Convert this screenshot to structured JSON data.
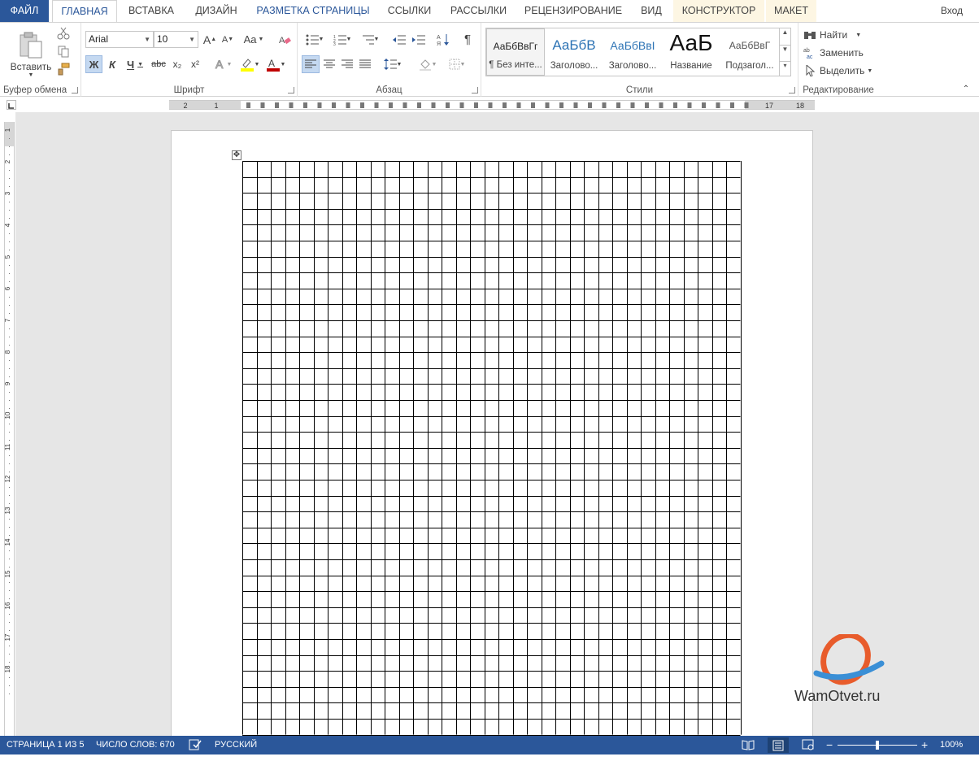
{
  "tabs": [
    {
      "label": "ФАЙЛ",
      "kind": "file"
    },
    {
      "label": "ГЛАВНАЯ",
      "kind": "active"
    },
    {
      "label": "ВСТАВКА",
      "kind": "normal"
    },
    {
      "label": "ДИЗАЙН",
      "kind": "normal"
    },
    {
      "label": "РАЗМЕТКА СТРАНИЦЫ",
      "kind": "blue"
    },
    {
      "label": "ССЫЛКИ",
      "kind": "normal"
    },
    {
      "label": "РАССЫЛКИ",
      "kind": "normal"
    },
    {
      "label": "РЕЦЕНЗИРОВАНИЕ",
      "kind": "normal"
    },
    {
      "label": "ВИД",
      "kind": "normal"
    },
    {
      "label": "КОНСТРУКТОР",
      "kind": "contextual"
    },
    {
      "label": "МАКЕТ",
      "kind": "contextual"
    }
  ],
  "signin": "Вход",
  "clipboard": {
    "paste_label": "Вставить",
    "group_label": "Буфер обмена",
    "icons": [
      "paste-icon",
      "cut-icon",
      "copy-icon",
      "format-painter-icon"
    ]
  },
  "font": {
    "name": "Arial",
    "size": "10",
    "group_label": "Шрифт",
    "bold": "Ж",
    "italic": "К",
    "underline": "Ч",
    "strike": "abc",
    "subscript": "x₂",
    "superscript": "x²",
    "grow": "A",
    "shrink": "A",
    "case": "Aa",
    "highlight_color": "#ffff00",
    "font_color": "#c00000"
  },
  "paragraph": {
    "group_label": "Абзац",
    "pilcrow": "¶",
    "icons": [
      "bullets-icon",
      "numbering-icon",
      "multilevel-list-icon",
      "decrease-indent-icon",
      "increase-indent-icon",
      "sort-icon",
      "show-marks-icon",
      "align-left-icon",
      "align-center-icon",
      "align-right-icon",
      "justify-icon",
      "line-spacing-icon",
      "shading-icon",
      "borders-icon"
    ]
  },
  "styles": {
    "group_label": "Стили",
    "items": [
      {
        "sample": "АаБбВвГг",
        "name": "¶ Без инте...",
        "selected": true
      },
      {
        "sample": "АаБбВ",
        "name": "Заголово...",
        "selected": false
      },
      {
        "sample": "АаБбВвІ",
        "name": "Заголово...",
        "selected": false
      },
      {
        "sample": "АаБ",
        "name": "Название",
        "selected": false
      },
      {
        "sample": "АаБбВвГ",
        "name": "Подзагол...",
        "selected": false
      }
    ]
  },
  "editing": {
    "group_label": "Редактирование",
    "find": "Найти",
    "replace": "Заменить",
    "select": "Выделить"
  },
  "ruler": {
    "horizontal_labels": [
      "2",
      "1",
      "17",
      "18"
    ],
    "vertical_labels": [
      "1",
      "2",
      "3",
      "4",
      "5",
      "6",
      "7",
      "8",
      "9",
      "10",
      "11",
      "12",
      "13",
      "14",
      "15",
      "16",
      "17",
      "18"
    ]
  },
  "document": {
    "table_columns": 35,
    "table_rows": 36
  },
  "watermark": {
    "text": "WamOtvet.ru"
  },
  "statusbar": {
    "page": "СТРАНИЦА 1 ИЗ 5",
    "words": "ЧИСЛО СЛОВ: 670",
    "language": "РУССКИЙ",
    "zoom": "100%",
    "zoom_level": 0.5,
    "zoom_minus": "−",
    "zoom_plus": "+"
  },
  "colors": {
    "accent": "#2b579a",
    "ribbon_bg": "#ffffff",
    "workspace": "#e6e6e6"
  }
}
